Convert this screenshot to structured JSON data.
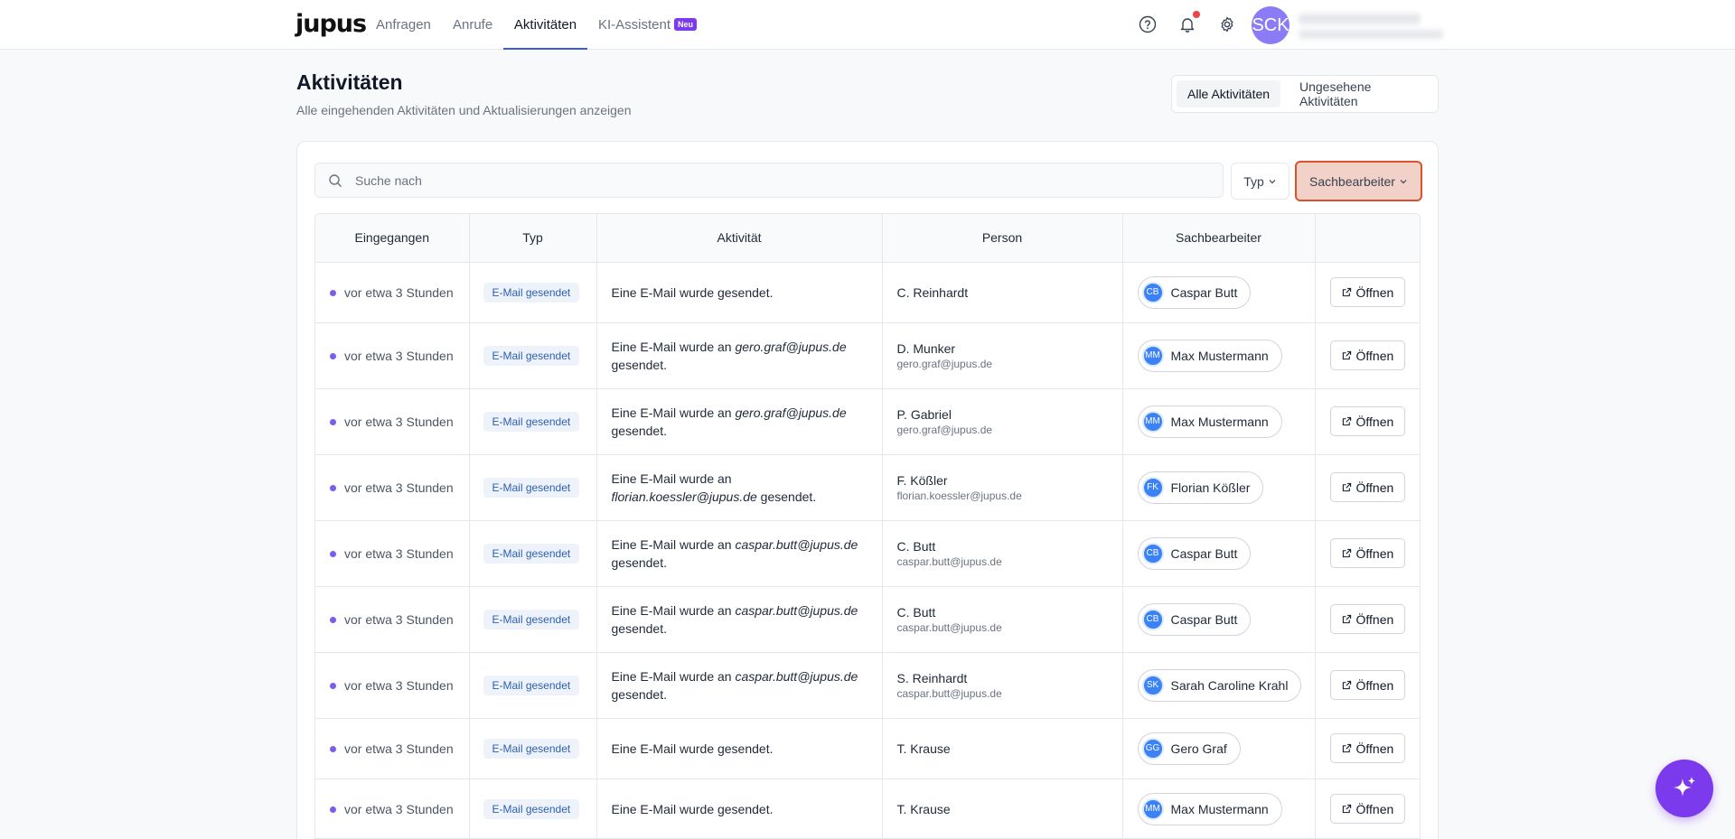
{
  "app": {
    "logo": "jupus"
  },
  "nav": {
    "items": [
      {
        "label": "Anfragen"
      },
      {
        "label": "Anrufe"
      },
      {
        "label": "Aktivitäten"
      },
      {
        "label": "KI-Assistent",
        "badge": "Neu"
      }
    ],
    "active": "Aktivitäten"
  },
  "user": {
    "initials": "SCK"
  },
  "header": {
    "title": "Aktivitäten",
    "subtitle": "Alle eingehenden Aktivitäten und Aktualisierungen anzeigen",
    "tabs": [
      "Alle Aktivitäten",
      "Ungesehene Aktivitäten"
    ],
    "active_tab": "Alle Aktivitäten"
  },
  "filters": {
    "search_placeholder": "Suche nach",
    "type_label": "Typ",
    "agent_label": "Sachbearbeiter"
  },
  "table": {
    "columns": [
      "Eingegangen",
      "Typ",
      "Aktivität",
      "Person",
      "Sachbearbeiter",
      ""
    ],
    "open_label": "Öffnen",
    "rows": [
      {
        "time": "vor etwa 3 Stunden",
        "type": "E-Mail gesendet",
        "act_pre": "Eine E-Mail wurde gesendet.",
        "act_email": "",
        "act_post": "",
        "person": "C. Reinhardt",
        "person_email": "",
        "agent_initials": "CB",
        "agent": "Caspar Butt"
      },
      {
        "time": "vor etwa 3 Stunden",
        "type": "E-Mail gesendet",
        "act_pre": "Eine E-Mail wurde an ",
        "act_email": "gero.graf@jupus.de",
        "act_post": " gesendet.",
        "person": "D. Munker",
        "person_email": "gero.graf@jupus.de",
        "agent_initials": "MM",
        "agent": "Max Mustermann"
      },
      {
        "time": "vor etwa 3 Stunden",
        "type": "E-Mail gesendet",
        "act_pre": "Eine E-Mail wurde an ",
        "act_email": "gero.graf@jupus.de",
        "act_post": " gesendet.",
        "person": "P. Gabriel",
        "person_email": "gero.graf@jupus.de",
        "agent_initials": "MM",
        "agent": "Max Mustermann"
      },
      {
        "time": "vor etwa 3 Stunden",
        "type": "E-Mail gesendet",
        "act_pre": "Eine E-Mail wurde an ",
        "act_email": "florian.koessler@jupus.de",
        "act_post": " gesendet.",
        "person": "F. Kößler",
        "person_email": "florian.koessler@jupus.de",
        "agent_initials": "FK",
        "agent": "Florian Kößler"
      },
      {
        "time": "vor etwa 3 Stunden",
        "type": "E-Mail gesendet",
        "act_pre": "Eine E-Mail wurde an ",
        "act_email": "caspar.butt@jupus.de",
        "act_post": " gesendet.",
        "person": "C. Butt",
        "person_email": "caspar.butt@jupus.de",
        "agent_initials": "CB",
        "agent": "Caspar Butt"
      },
      {
        "time": "vor etwa 3 Stunden",
        "type": "E-Mail gesendet",
        "act_pre": "Eine E-Mail wurde an ",
        "act_email": "caspar.butt@jupus.de",
        "act_post": " gesendet.",
        "person": "C. Butt",
        "person_email": "caspar.butt@jupus.de",
        "agent_initials": "CB",
        "agent": "Caspar Butt"
      },
      {
        "time": "vor etwa 3 Stunden",
        "type": "E-Mail gesendet",
        "act_pre": "Eine E-Mail wurde an ",
        "act_email": "caspar.butt@jupus.de",
        "act_post": " gesendet.",
        "person": "S. Reinhardt",
        "person_email": "caspar.butt@jupus.de",
        "agent_initials": "SK",
        "agent": "Sarah Caroline Krahl"
      },
      {
        "time": "vor etwa 3 Stunden",
        "type": "E-Mail gesendet",
        "act_pre": "Eine E-Mail wurde gesendet.",
        "act_email": "",
        "act_post": "",
        "person": "T. Krause",
        "person_email": "",
        "agent_initials": "GG",
        "agent": "Gero Graf"
      },
      {
        "time": "vor etwa 3 Stunden",
        "type": "E-Mail gesendet",
        "act_pre": "Eine E-Mail wurde gesendet.",
        "act_email": "",
        "act_post": "",
        "person": "T. Krause",
        "person_email": "",
        "agent_initials": "MM",
        "agent": "Max Mustermann"
      }
    ]
  },
  "colors": {
    "accent": "#7c3aed",
    "highlight_border": "#d9532b",
    "badge_text": "#2b5fb3"
  },
  "icons": [
    "help-circle-icon",
    "bell-icon",
    "gear-icon",
    "search-icon",
    "chevron-down-icon",
    "external-link-icon",
    "sparkle-icon"
  ]
}
